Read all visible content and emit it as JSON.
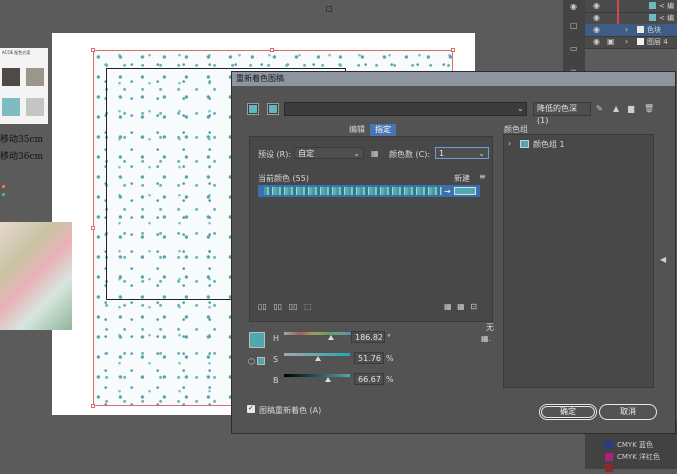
{
  "workspace": {
    "side_text_1": "移动35cm",
    "side_text_2": "移动36cm",
    "card_header": "ACOE 配色方案",
    "card_swatches": [
      "#4f4a45",
      "#9b958a",
      "#7fbcc0",
      "#c3c6c3"
    ]
  },
  "layers_panel": {
    "rows": [
      {
        "name": "< 编",
        "swatch": "#6fb9bd"
      },
      {
        "name": "< 编",
        "swatch": "#6fb9bd"
      },
      {
        "name": "色块",
        "swatch": "#e8e8e8"
      },
      {
        "name": "图层 4",
        "swatch": "#f0f0f0"
      }
    ]
  },
  "swatch_list": {
    "rows": [
      {
        "label": "CMYK 蓝色",
        "color": "#2c3a8a"
      },
      {
        "label": "CMYK 洋红色",
        "color": "#b0207a"
      },
      {
        "label": "",
        "color": "#8a2a2a"
      }
    ]
  },
  "dialog": {
    "title": "重新着色图稿",
    "preset_library_label": "降低的色深 (1)",
    "tabs": {
      "edit": "编辑",
      "assign": "指定"
    },
    "preset_label": "预设 (R):",
    "preset_value": "自定",
    "color_count_label": "颜色数 (C):",
    "color_count_value": "1",
    "current_colors_label": "当前颜色 (55)",
    "new_label": "新建",
    "color_groups_label": "颜色组",
    "color_group_item": "颜色组 1",
    "none_label": "无",
    "hsb": {
      "h_label": "H",
      "h_value": "186.82",
      "h_unit": "°",
      "s_label": "S",
      "s_value": "51.76",
      "s_unit": "%",
      "b_label": "B",
      "b_value": "66.67",
      "b_unit": "%"
    },
    "selected_color": "#50a7ae",
    "hsb_levels": {
      "h": 0.519,
      "s": 0.518,
      "b": 0.667
    },
    "recolor_checkbox_label": "图稿重新着色 (A)",
    "ok_label": "确定",
    "cancel_label": "取消"
  }
}
